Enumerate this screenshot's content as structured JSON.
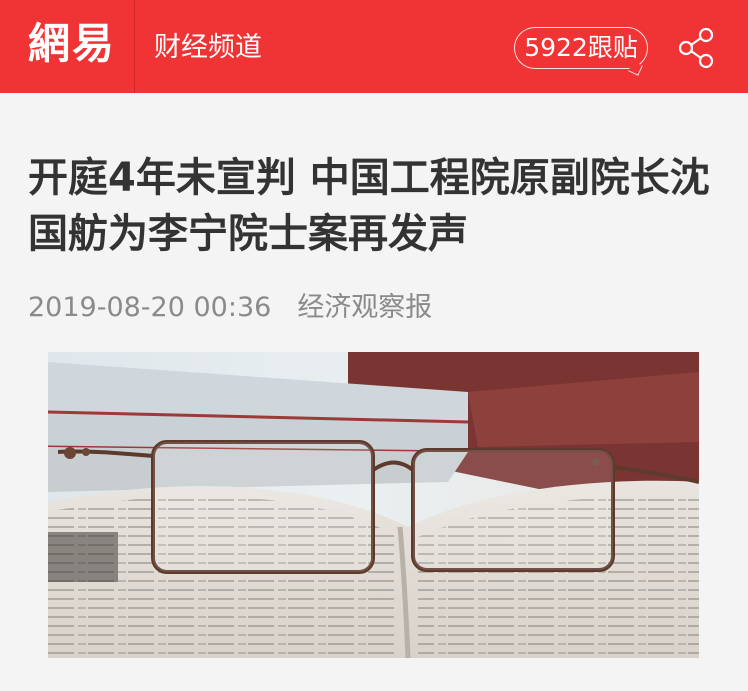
{
  "header": {
    "logo": "網易",
    "channel": "财经频道",
    "follow_label": "5922跟贴",
    "share_icon": "share-icon",
    "brand_color": "#f03334"
  },
  "article": {
    "title": "开庭4年未宣判 中国工程院原副院长沈国舫为李宁院士案再发声",
    "date": "2019-08-20 00:36",
    "source": "经济观察报"
  },
  "image": {
    "subject": "eyeglasses-on-open-book"
  }
}
